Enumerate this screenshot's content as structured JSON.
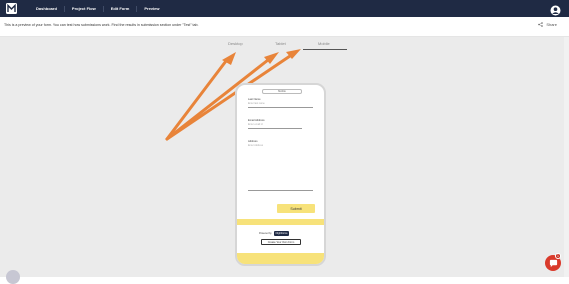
{
  "topbar": {
    "logo_icon": "brand-logo-icon",
    "nav": [
      {
        "label": "Dashboard"
      },
      {
        "label": "Project Flow"
      },
      {
        "label": "Edit Form"
      },
      {
        "label": "Preview"
      }
    ],
    "account_icon": "user-avatar-icon"
  },
  "subbar": {
    "info": "This is a preview of your form. You can test how submissions work. Find the results in submission section under \"Test\" tab.",
    "share_label": "Share"
  },
  "tabs": [
    {
      "label": "Desktop"
    },
    {
      "label": "Tablet"
    },
    {
      "label": "Mobile",
      "active": true
    }
  ],
  "annotation": {
    "arrow_color": "#e8843a"
  },
  "phone": {
    "header": "Mobile",
    "fields": [
      {
        "label": "Last Name",
        "placeholder": "Enter last name"
      },
      {
        "label": "Email Address",
        "placeholder": "Enter email id"
      },
      {
        "label": "Address",
        "placeholder": "Enter Address"
      }
    ],
    "submit_label": "Submit",
    "powered_by": "Powered by",
    "brand": "Flightforms",
    "create_button": "Create Your Own Form"
  },
  "chat": {
    "badge": "1"
  },
  "colors": {
    "topbar": "#1f2a44",
    "accent_yellow": "#f7e27a",
    "chat": "#d93a2b"
  }
}
